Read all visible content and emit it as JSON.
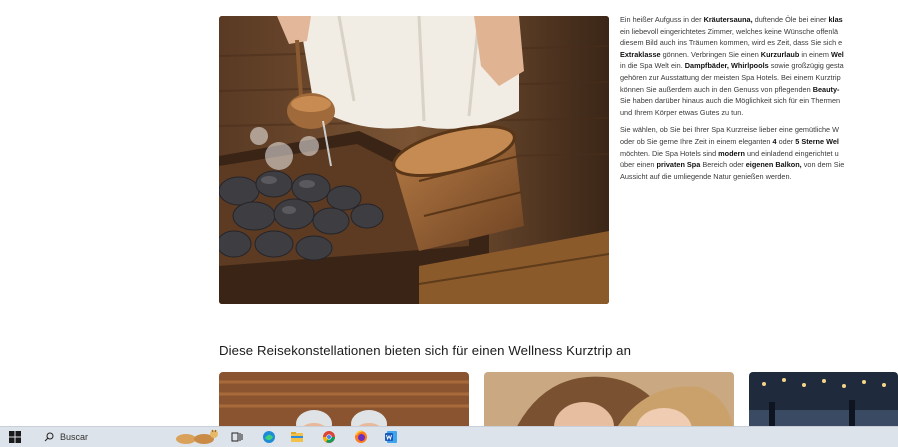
{
  "article": {
    "p1": [
      [
        {
          "t": "Ein heißer Aufguss in der "
        },
        {
          "t": "Kräutersauna,",
          "b": true
        },
        {
          "t": " duftende Öle bei einer "
        },
        {
          "t": "klas",
          "b": true
        }
      ],
      [
        {
          "t": "ein liebevoll eingerichtetes Zimmer, welches keine Wünsche offenlä"
        }
      ],
      [
        {
          "t": "diesem Bild auch ins Träumen kommen, wird es Zeit, dass Sie sich e"
        }
      ],
      [
        {
          "t": "Extraklasse",
          "b": true
        },
        {
          "t": " gönnen. Verbringen Sie einen "
        },
        {
          "t": "Kurzurlaub",
          "b": true
        },
        {
          "t": " in einem "
        },
        {
          "t": "Wel",
          "b": true
        }
      ],
      [
        {
          "t": "in die Spa Welt ein. "
        },
        {
          "t": "Dampfbäder, Whirlpools",
          "b": true
        },
        {
          "t": " sowie großzügig gesta"
        }
      ],
      [
        {
          "t": "gehören zur Ausstattung der meisten Spa Hotels. Bei einem Kurztrip"
        }
      ],
      [
        {
          "t": "können Sie außerdem auch in den Genuss von pflegenden "
        },
        {
          "t": "Beauty-",
          "b": true
        }
      ],
      [
        {
          "t": "Sie haben darüber hinaus auch die Möglichkeit sich für ein Thermen"
        }
      ],
      [
        {
          "t": "und Ihrem Körper etwas Gutes zu tun."
        }
      ]
    ],
    "p2": [
      [
        {
          "t": "Sie wählen, ob Sie bei Ihrer Spa Kurzreise lieber eine gemütliche W"
        }
      ],
      [
        {
          "t": "oder ob Sie gerne Ihre Zeit in einem eleganten "
        },
        {
          "t": "4",
          "b": true
        },
        {
          "t": " oder "
        },
        {
          "t": "5 Sterne Wel",
          "b": true
        }
      ],
      [
        {
          "t": "möchten. Die Spa Hotels sind "
        },
        {
          "t": "modern",
          "b": true
        },
        {
          "t": " und einladend eingerichtet u"
        }
      ],
      [
        {
          "t": "über einen "
        },
        {
          "t": "privaten Spa",
          "b": true
        },
        {
          "t": " Bereich oder "
        },
        {
          "t": "eigenen Balkon,",
          "b": true
        },
        {
          "t": " von dem Sie"
        }
      ],
      [
        {
          "t": "Aussicht auf die umliegende Natur genießen werden."
        }
      ]
    ]
  },
  "section": {
    "title": "Diese Reisekonstellationen bieten sich für einen Wellness Kurztrip an"
  },
  "cards": [
    {
      "icon": "sauna-couple-photo"
    },
    {
      "icon": "mother-daughter-photo"
    },
    {
      "icon": "evening-lights-photo"
    }
  ],
  "taskbar": {
    "search_placeholder": "Buscar",
    "icons": [
      "start-icon",
      "search-icon",
      "cat-widget-icon",
      "task-view-icon",
      "edge-icon",
      "file-explorer-icon",
      "chrome-icon",
      "firefox-icon",
      "word-icon"
    ]
  },
  "colors": {
    "taskbar_bg": "#dde3ea",
    "text": "#3a3a3a",
    "heading": "#1b1b1b"
  }
}
